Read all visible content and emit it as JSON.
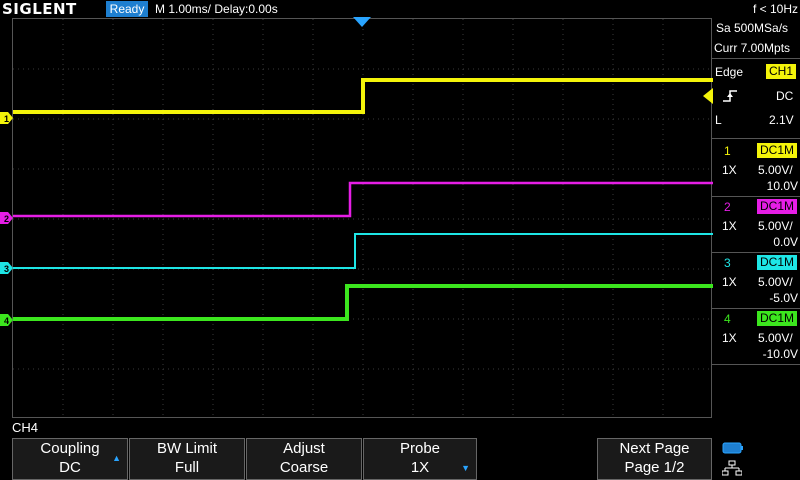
{
  "header": {
    "brand": "SIGLENT",
    "status": "Ready",
    "timebase": "M 1.00ms/ Delay:0.00s",
    "frequency": "f < 10Hz"
  },
  "acquisition": {
    "sample_rate": "Sa 500MSa/s",
    "memory": "Curr 7.00Mpts"
  },
  "trigger": {
    "type": "Edge",
    "source": "CH1",
    "slope_icon": "rising-edge-icon",
    "coupling": "DC",
    "mode": "L",
    "level": "2.1V"
  },
  "channels": [
    {
      "number": "1",
      "coupling": "DC1M",
      "probe": "1X",
      "scale": "5.00V/",
      "offset": "10.0V",
      "color": "#f4f40a"
    },
    {
      "number": "2",
      "coupling": "DC1M",
      "probe": "1X",
      "scale": "5.00V/",
      "offset": "0.0V",
      "color": "#e61ee6"
    },
    {
      "number": "3",
      "coupling": "DC1M",
      "probe": "1X",
      "scale": "5.00V/",
      "offset": "-5.0V",
      "color": "#1ee6e6"
    },
    {
      "number": "4",
      "coupling": "DC1M",
      "probe": "1X",
      "scale": "5.00V/",
      "offset": "-10.0V",
      "color": "#3ce61e"
    }
  ],
  "menu": {
    "channel": "CH4",
    "softkeys": [
      {
        "line1": "Coupling",
        "line2": "DC",
        "arrow": "up"
      },
      {
        "line1": "BW Limit",
        "line2": "Full",
        "arrow": ""
      },
      {
        "line1": "Adjust",
        "line2": "Coarse",
        "arrow": ""
      },
      {
        "line1": "Probe",
        "line2": "1X",
        "arrow": "down"
      },
      {
        "line1": "Next Page",
        "line2": "Page 1/2",
        "arrow": ""
      }
    ]
  },
  "icons": {
    "usb": "usb-icon",
    "network": "network-icon"
  }
}
